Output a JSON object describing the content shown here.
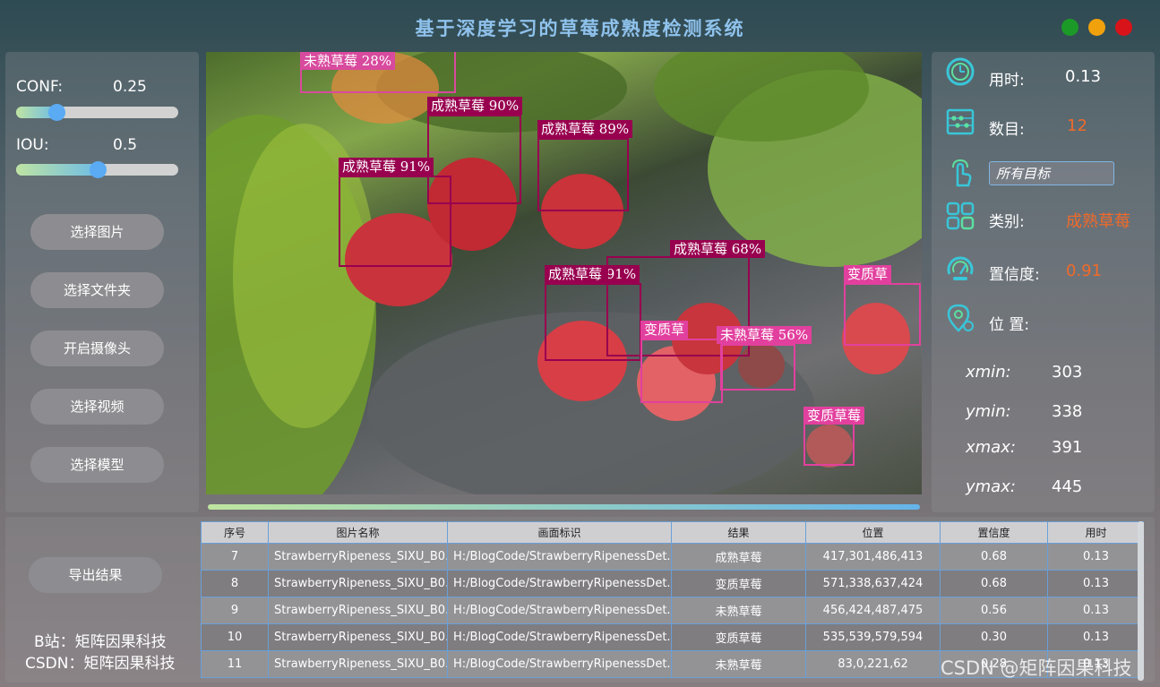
{
  "window": {
    "title": "基于深度学习的草莓成熟度检测系统",
    "controls": [
      "green",
      "yellow",
      "red"
    ],
    "control_colors": {
      "green": "#1c9a28",
      "yellow": "#f1a10c",
      "red": "#d8141a"
    }
  },
  "sliders": {
    "conf": {
      "label": "CONF:",
      "value": "0.25",
      "level": 0.25
    },
    "iou": {
      "label": "IOU:",
      "value": "0.5",
      "level": 0.5
    }
  },
  "sidebar_buttons": {
    "select_image": "选择图片",
    "select_folder": "选择文件夹",
    "open_camera": "开启摄像头",
    "select_video": "选择视频",
    "select_model": "选择模型"
  },
  "export_button": "导出结果",
  "credits": {
    "bilibili": "B站：矩阵因果科技",
    "csdn": "CSDN：矩阵因果科技"
  },
  "detections": [
    {
      "label": "未熟草莓 28%",
      "color": "#d84a9e"
    },
    {
      "label": "成熟草莓 90%",
      "color": "#98004f"
    },
    {
      "label": "成熟草莓 89%",
      "color": "#98004f"
    },
    {
      "label": "成熟草莓 91%",
      "color": "#98004f"
    },
    {
      "label": "成熟草莓 91%",
      "color": "#98004f"
    },
    {
      "label": "成熟草莓 68%",
      "color": "#98004f"
    },
    {
      "label": "变质草",
      "color": "#e2409e"
    },
    {
      "label": "变质草",
      "color": "#e2409e"
    },
    {
      "label": "未熟草莓 56%",
      "color": "#e2409e"
    },
    {
      "label": "变质草莓",
      "color": "#e2409e"
    }
  ],
  "info": {
    "time": {
      "label": "用时:",
      "value": "0.13"
    },
    "count": {
      "label": "数目:",
      "value": "12"
    },
    "target_select": {
      "value": "所有目标"
    },
    "class": {
      "label": "类别:",
      "value": "成熟草莓"
    },
    "confidence": {
      "label": "置信度:",
      "value": "0.91"
    },
    "position": {
      "label": "位 置:"
    },
    "coords": {
      "xmin": {
        "label": "xmin:",
        "value": "303"
      },
      "ymin": {
        "label": "ymin:",
        "value": "338"
      },
      "xmax": {
        "label": "xmax:",
        "value": "391"
      },
      "ymax": {
        "label": "ymax:",
        "value": "445"
      }
    },
    "accent_color": "#f06a2a",
    "icon_color": "#39c6d8"
  },
  "table": {
    "headers": [
      "序号",
      "图片名称",
      "画面标识",
      "结果",
      "位置",
      "置信度",
      "用时"
    ],
    "rows": [
      [
        "7",
        "StrawberryRipeness_SIXU_B0...",
        "H:/BlogCode/StrawberryRipenessDet...",
        "成熟草莓",
        "417,301,486,413",
        "0.68",
        "0.13"
      ],
      [
        "8",
        "StrawberryRipeness_SIXU_B0...",
        "H:/BlogCode/StrawberryRipenessDet...",
        "变质草莓",
        "571,338,637,424",
        "0.68",
        "0.13"
      ],
      [
        "9",
        "StrawberryRipeness_SIXU_B0...",
        "H:/BlogCode/StrawberryRipenessDet...",
        "未熟草莓",
        "456,424,487,475",
        "0.56",
        "0.13"
      ],
      [
        "10",
        "StrawberryRipeness_SIXU_B0...",
        "H:/BlogCode/StrawberryRipenessDet...",
        "变质草莓",
        "535,539,579,594",
        "0.30",
        "0.13"
      ],
      [
        "11",
        "StrawberryRipeness_SIXU_B0...",
        "H:/BlogCode/StrawberryRipenessDet...",
        "未熟草莓",
        "83,0,221,62",
        "0.28",
        "0.13"
      ]
    ]
  },
  "watermark": "CSDN @矩阵因果科技"
}
